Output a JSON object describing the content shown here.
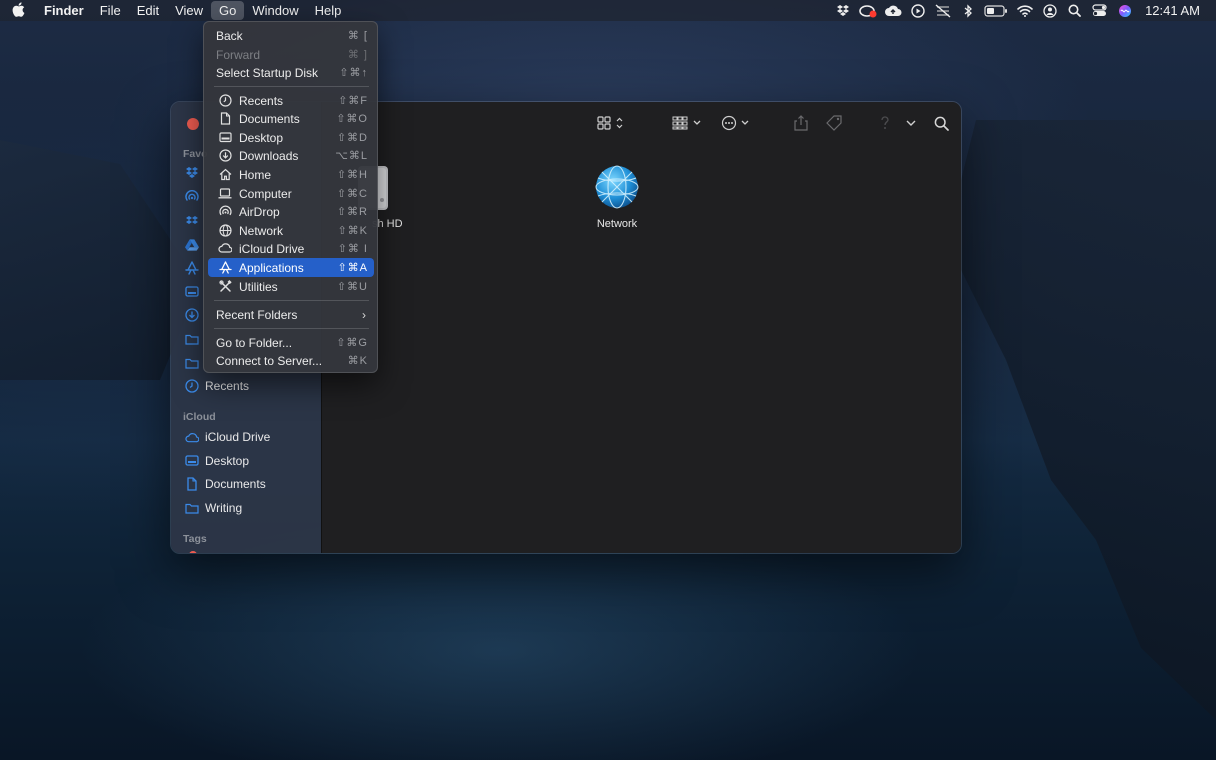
{
  "menubar": {
    "apple": "",
    "items": [
      "Finder",
      "File",
      "Edit",
      "View",
      "Go",
      "Window",
      "Help"
    ],
    "active_index": 4,
    "clock": "12:41 AM"
  },
  "go_menu": {
    "items": [
      {
        "label": "Back",
        "shortcut": "⌘ [",
        "disabled": false
      },
      {
        "label": "Forward",
        "shortcut": "⌘ ]",
        "disabled": true
      },
      {
        "label": "Select Startup Disk",
        "shortcut": "⇧⌘↑",
        "disabled": false
      },
      {
        "label": "Recents",
        "shortcut": "⇧⌘F",
        "icon": "clock-icon"
      },
      {
        "label": "Documents",
        "shortcut": "⇧⌘O",
        "icon": "document-icon"
      },
      {
        "label": "Desktop",
        "shortcut": "⇧⌘D",
        "icon": "desktop-icon"
      },
      {
        "label": "Downloads",
        "shortcut": "⌥⌘L",
        "icon": "download-icon"
      },
      {
        "label": "Home",
        "shortcut": "⇧⌘H",
        "icon": "home-icon"
      },
      {
        "label": "Computer",
        "shortcut": "⇧⌘C",
        "icon": "laptop-icon"
      },
      {
        "label": "AirDrop",
        "shortcut": "⇧⌘R",
        "icon": "airdrop-icon"
      },
      {
        "label": "Network",
        "shortcut": "⇧⌘K",
        "icon": "globe-icon"
      },
      {
        "label": "iCloud Drive",
        "shortcut": "⇧⌘ I",
        "icon": "cloud-icon"
      },
      {
        "label": "Applications",
        "shortcut": "⇧⌘A",
        "icon": "applications-icon",
        "selected": true
      },
      {
        "label": "Utilities",
        "shortcut": "⇧⌘U",
        "icon": "tools-icon"
      },
      {
        "label": "Recent Folders",
        "submenu": true
      },
      {
        "label": "Go to Folder...",
        "shortcut": "⇧⌘G"
      },
      {
        "label": "Connect to Server...",
        "shortcut": "⌘K"
      }
    ]
  },
  "sidebar": {
    "favorites_label": "Favo",
    "recents_label": "Recents",
    "icloud_section": "iCloud",
    "icloud_items": [
      "iCloud Drive",
      "Desktop",
      "Documents",
      "Writing"
    ],
    "tags_section": "Tags"
  },
  "content": {
    "items": [
      {
        "label": "sh HD"
      },
      {
        "label": "Network"
      }
    ]
  },
  "colors": {
    "accent": "#2560c9",
    "close_button": "#ee5b50",
    "sidebar_icon": "#3b8bea"
  }
}
